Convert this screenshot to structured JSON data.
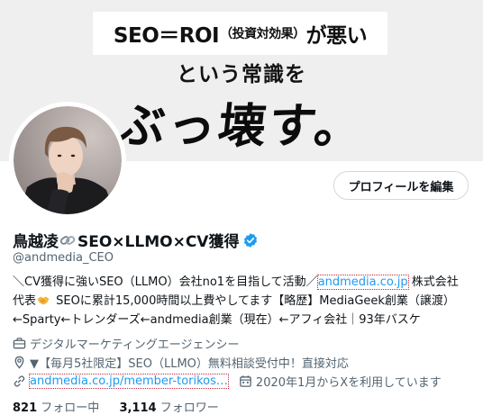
{
  "banner": {
    "headline_part1": "SEO＝ROI",
    "headline_paren": "（投資対効果）",
    "headline_part2": "が悪い",
    "line2": "という常識を",
    "line3": "ぶっ壊す。"
  },
  "profile": {
    "display_name_part1": "鳥越凌",
    "display_name_part2": "SEO×LLMO×CV獲得",
    "handle": "@andmedia_CEO",
    "edit_button_label": "プロフィールを編集"
  },
  "bio": {
    "line1_text": "＼CV獲得に強いSEO（LLMO）会社no1を目指して活動／",
    "line1_link": "andmedia.co.jp",
    "line1_suffix": " 株式会社",
    "line2_prefix": "代表",
    "line2_text": " SEOに累計15,000時間以上費やしてます【略歴】MediaGeek創業（譲渡）",
    "line3_text": "←Sparty←トレンダーズ←andmedia創業（現在）←アフィ会社｜93年バスケ"
  },
  "info": {
    "category": "デジタルマーケティングエージェンシー",
    "location": "▼【毎月5社限定】SEO（LLMO）無料相談受付中！直接対応",
    "website": "andmedia.co.jp/member-torikos…",
    "joined": "2020年1月からXを利用しています"
  },
  "stats": {
    "following_count": "821",
    "following_label": "フォロー中",
    "followers_count": "3,114",
    "followers_label": "フォロワー"
  },
  "colors": {
    "accent": "#1d9bf0",
    "secondary_text": "#536471",
    "primary_text": "#0f1419"
  },
  "icons": [
    "link-emoji-icon",
    "verified-badge-icon",
    "handshake-emoji-icon",
    "briefcase-icon",
    "location-pin-icon",
    "link-icon",
    "calendar-icon"
  ]
}
